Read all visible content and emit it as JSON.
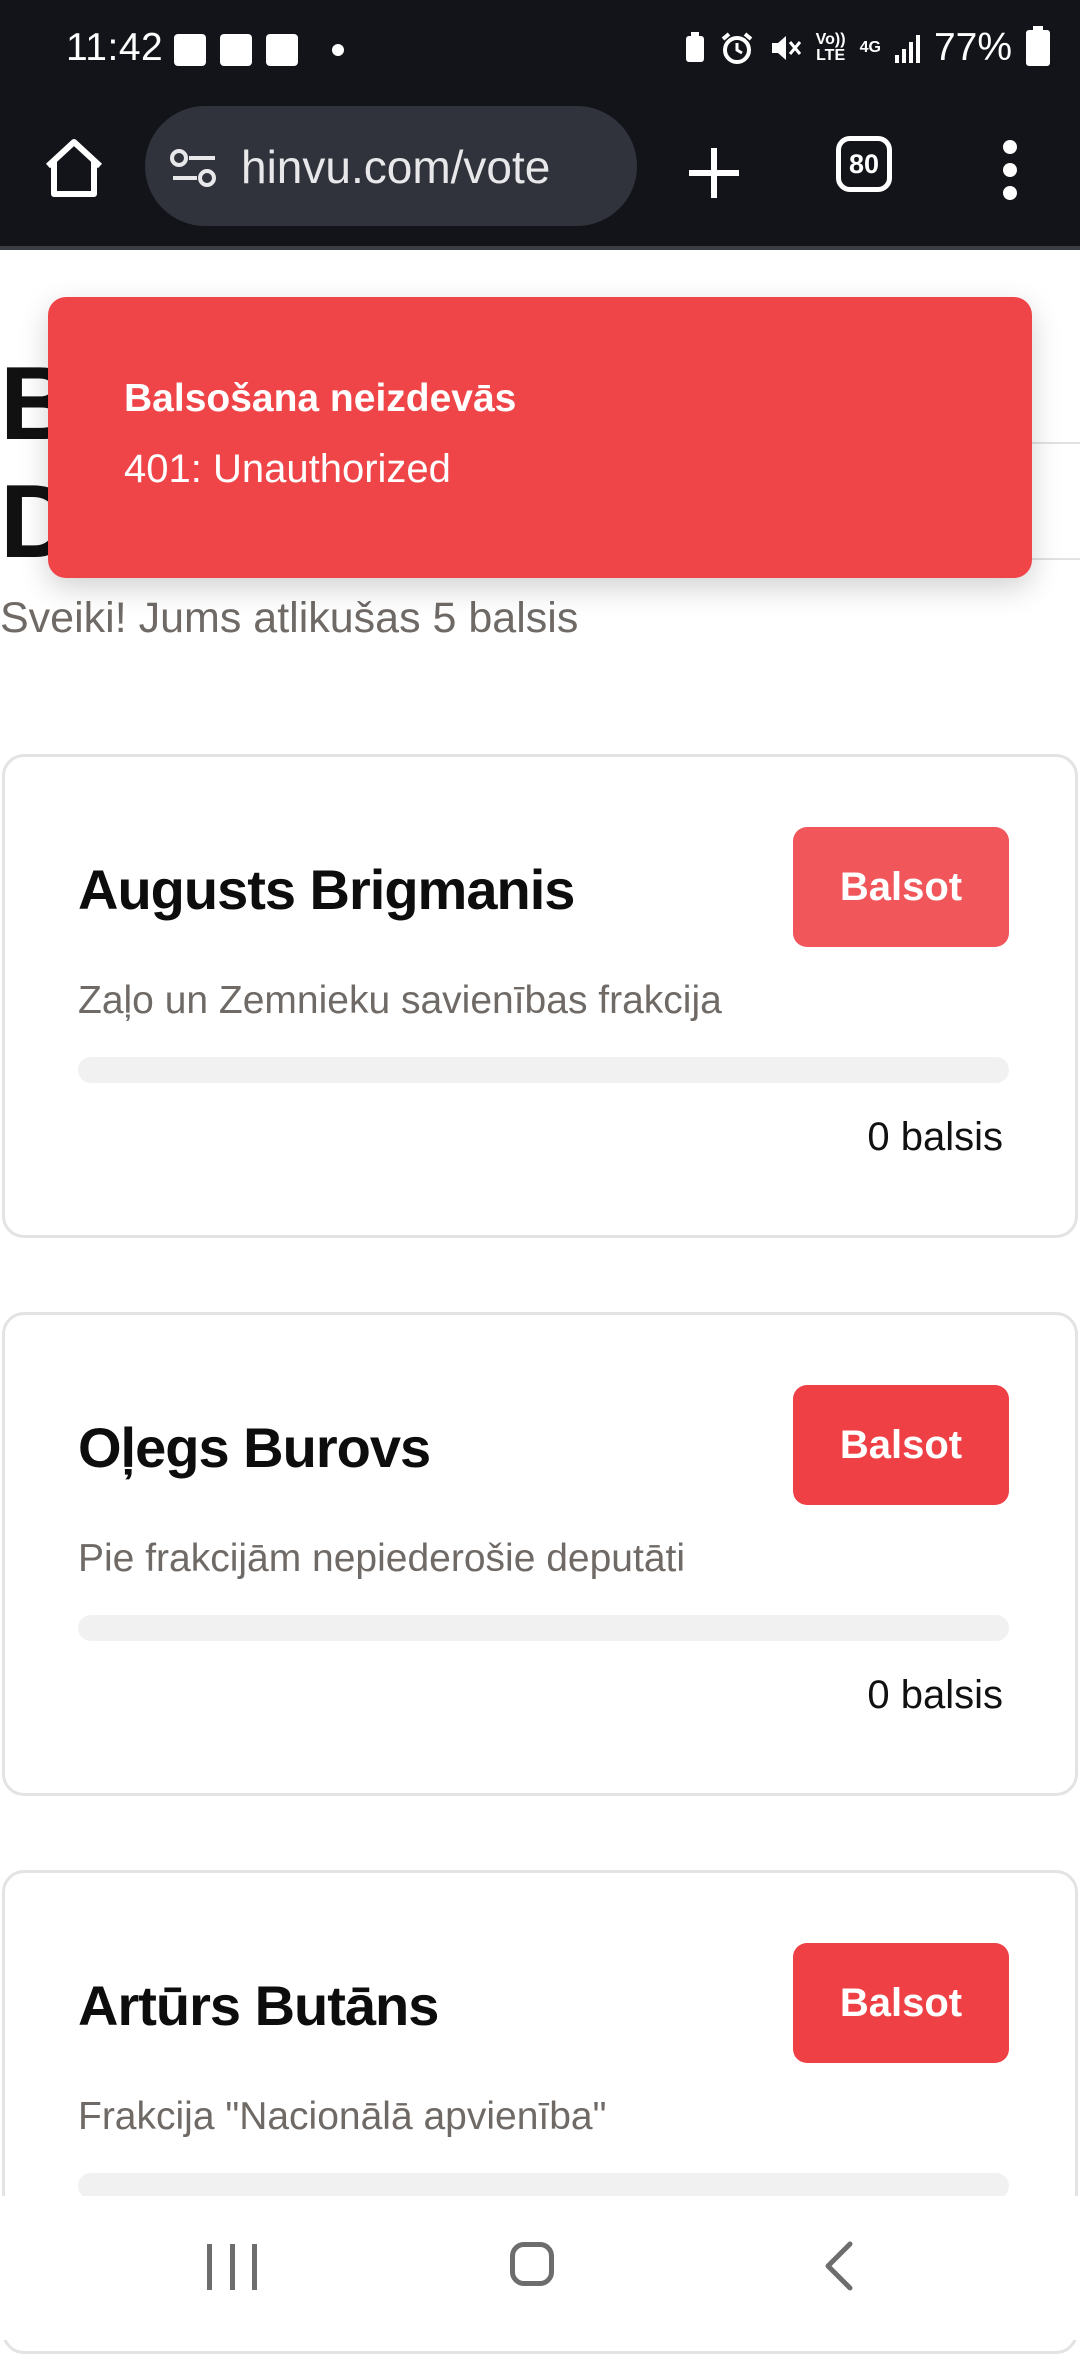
{
  "status_bar": {
    "time": "11:42",
    "battery": "77%",
    "volte": "Vo)) LTE",
    "network": "4G"
  },
  "browser": {
    "url": "hinvu.com/vote",
    "tab_count": "80"
  },
  "page": {
    "title_partial": "B\nD",
    "greeting": "Sveiki! Jums atlikušas 5 balsis"
  },
  "toast": {
    "title": "Balsošana neizdevās",
    "message": "401: Unauthorized"
  },
  "candidates": [
    {
      "name": "Augusts Brigmanis",
      "party": "Zaļo un Zemnieku savienības frakcija",
      "button": "Balsot",
      "votes": "0 balsis",
      "progress": 0
    },
    {
      "name": "Oļegs Burovs",
      "party": "Pie frakcijām nepiederošie deputāti",
      "button": "Balsot",
      "votes": "0 balsis",
      "progress": 0
    },
    {
      "name": "Artūrs Butāns",
      "party": "Frakcija \"Nacionālā apvienība\"",
      "button": "Balsot",
      "votes": "",
      "progress": 0
    }
  ],
  "colors": {
    "accent": "#ee4045",
    "toast": "#ef4548",
    "browser_bg": "#12141a"
  }
}
